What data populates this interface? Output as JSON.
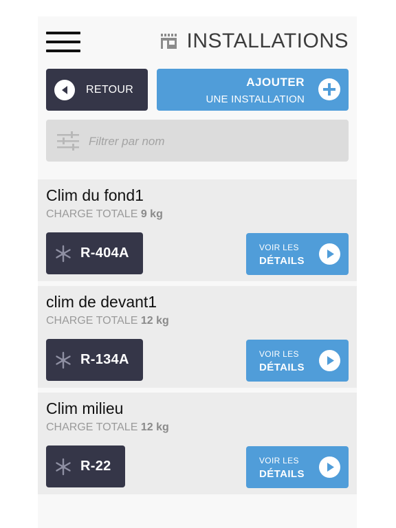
{
  "header": {
    "title": "INSTALLATIONS",
    "menu_icon": "hamburger-menu-icon",
    "title_icon": "building-icon"
  },
  "actions": {
    "back_label": "RETOUR",
    "add_label_line1": "AJOUTER",
    "add_label_line2": "UNE INSTALLATION"
  },
  "filter": {
    "placeholder": "Filtrer par nom",
    "value": "",
    "icon": "sliders-icon"
  },
  "installations": [
    {
      "name": "Clim du fond1",
      "charge_label": "CHARGE TOTALE",
      "charge_value": "9 kg",
      "refrigerant": "R-404A",
      "details_line1": "VOIR LES",
      "details_line2": "DÉTAILS"
    },
    {
      "name": "clim de devant1",
      "charge_label": "CHARGE TOTALE",
      "charge_value": "12 kg",
      "refrigerant": "R-134A",
      "details_line1": "VOIR LES",
      "details_line2": "DÉTAILS"
    },
    {
      "name": "Clim milieu",
      "charge_label": "CHARGE TOTALE",
      "charge_value": "12 kg",
      "refrigerant": "R-22",
      "details_line1": "VOIR LES",
      "details_line2": "DÉTAILS"
    }
  ],
  "colors": {
    "dark": "#353648",
    "accent": "#509dd9",
    "card_bg": "#ececec",
    "filter_bg": "#dcdcdc"
  }
}
